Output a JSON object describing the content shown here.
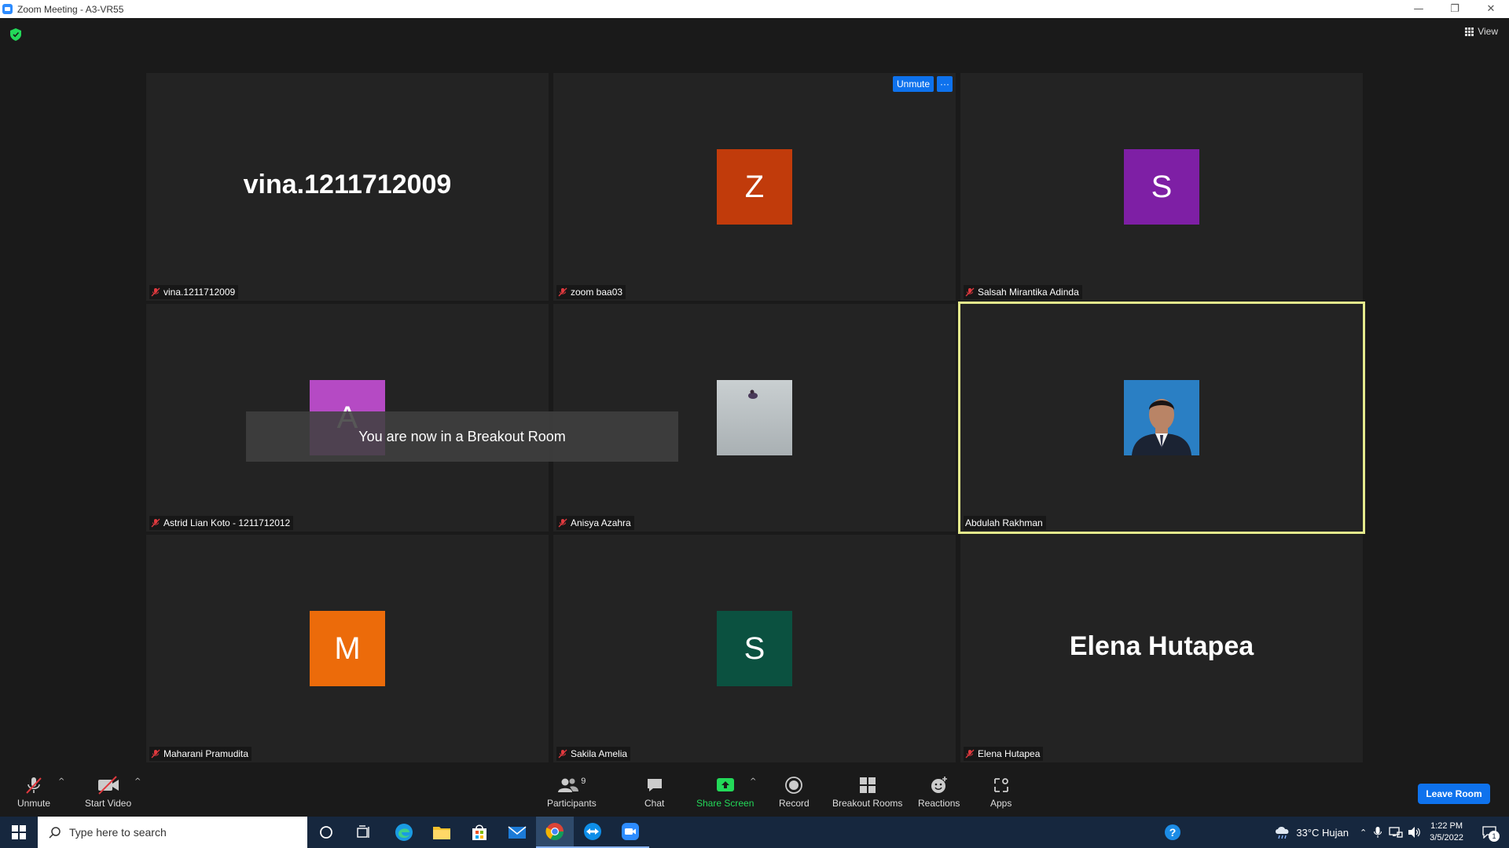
{
  "window": {
    "title": "Zoom Meeting - A3-VR55",
    "minimize": "—",
    "restore": "❐",
    "close": "✕"
  },
  "header": {
    "view_label": "View"
  },
  "unmute_overlay": {
    "unmute_label": "Unmute",
    "more_label": "···"
  },
  "tiles": [
    {
      "display_name": "vina.1211712009",
      "big_name": "vina.1211712009",
      "muted": true
    },
    {
      "display_name": "zoom baa03",
      "initial": "Z",
      "avatar_color": "#c13b0b",
      "muted": true
    },
    {
      "display_name": "Salsah Mirantika Adinda",
      "initial": "S",
      "avatar_color": "#7e1fa5",
      "muted": true
    },
    {
      "display_name": "Astrid Lian Koto - 1211712012",
      "initial": "A",
      "avatar_color": "#b54ac4",
      "muted": true
    },
    {
      "display_name": "Anisya Azahra",
      "muted": true
    },
    {
      "display_name": "Abdulah Rakhman",
      "muted": false,
      "active_speaker": true
    },
    {
      "display_name": "Maharani Pramudita",
      "initial": "M",
      "avatar_color": "#ec6b0a",
      "muted": true
    },
    {
      "display_name": "Sakila Amelia",
      "initial": "S",
      "avatar_color": "#0b5140",
      "muted": true
    },
    {
      "display_name": "Elena Hutapea",
      "big_name": "Elena Hutapea",
      "muted": true
    }
  ],
  "toast": {
    "message": "You are now in a Breakout Room"
  },
  "toolbar": {
    "unmute": "Unmute",
    "start_video": "Start Video",
    "participants": "Participants",
    "participants_count": "9",
    "chat": "Chat",
    "share_screen": "Share Screen",
    "record": "Record",
    "breakout_rooms": "Breakout Rooms",
    "reactions": "Reactions",
    "apps": "Apps",
    "leave_room": "Leave Room",
    "caret": "^"
  },
  "taskbar": {
    "search_placeholder": "Type here to search",
    "weather": "33°C  Hujan",
    "time": "1:22 PM",
    "date": "3/5/2022",
    "notification_count": "1"
  },
  "colors": {
    "accent": "#0e72ed",
    "share_green": "#23d959",
    "active_border": "#e4ea8c",
    "muted_red": "#e0393e"
  }
}
